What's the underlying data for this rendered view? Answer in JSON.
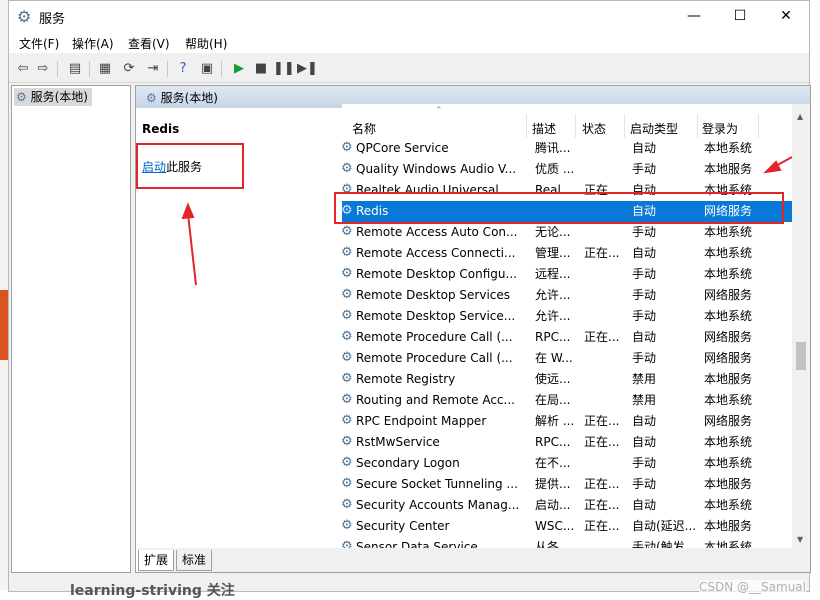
{
  "window": {
    "title": "服务",
    "min": "—",
    "max": "☐",
    "close": "✕"
  },
  "menu": [
    "文件(F)",
    "操作(A)",
    "查看(V)",
    "帮助(H)"
  ],
  "left_tree": {
    "root": "服务(本地)"
  },
  "right_header": "服务(本地)",
  "detail": {
    "service_name": "Redis",
    "start_link": "启动",
    "start_suffix": "此服务"
  },
  "columns": [
    "名称",
    "描述",
    "状态",
    "启动类型",
    "登录为"
  ],
  "services": [
    {
      "name": "QPCore Service",
      "desc": "腾讯...",
      "status": "",
      "start": "自动",
      "logon": "本地系统"
    },
    {
      "name": "Quality Windows Audio V...",
      "desc": "优质 ...",
      "status": "",
      "start": "手动",
      "logon": "本地服务"
    },
    {
      "name": "Realtek Audio Universal ...",
      "desc": "Real...",
      "status": "正在...",
      "start": "自动",
      "logon": "本地系统"
    },
    {
      "name": "Redis",
      "desc": "",
      "status": "",
      "start": "自动",
      "logon": "网络服务",
      "selected": true
    },
    {
      "name": "Remote Access Auto Con...",
      "desc": "无论...",
      "status": "",
      "start": "手动",
      "logon": "本地系统"
    },
    {
      "name": "Remote Access Connecti...",
      "desc": "管理...",
      "status": "正在...",
      "start": "自动",
      "logon": "本地系统"
    },
    {
      "name": "Remote Desktop Configu...",
      "desc": "远程...",
      "status": "",
      "start": "手动",
      "logon": "本地系统"
    },
    {
      "name": "Remote Desktop Services",
      "desc": "允许...",
      "status": "",
      "start": "手动",
      "logon": "网络服务"
    },
    {
      "name": "Remote Desktop Service...",
      "desc": "允许...",
      "status": "",
      "start": "手动",
      "logon": "本地系统"
    },
    {
      "name": "Remote Procedure Call (...",
      "desc": "RPC...",
      "status": "正在...",
      "start": "自动",
      "logon": "网络服务"
    },
    {
      "name": "Remote Procedure Call (...",
      "desc": "在 W...",
      "status": "",
      "start": "手动",
      "logon": "网络服务"
    },
    {
      "name": "Remote Registry",
      "desc": "使远...",
      "status": "",
      "start": "禁用",
      "logon": "本地服务"
    },
    {
      "name": "Routing and Remote Acc...",
      "desc": "在局...",
      "status": "",
      "start": "禁用",
      "logon": "本地系统"
    },
    {
      "name": "RPC Endpoint Mapper",
      "desc": "解析 ...",
      "status": "正在...",
      "start": "自动",
      "logon": "网络服务"
    },
    {
      "name": "RstMwService",
      "desc": "RPC...",
      "status": "正在...",
      "start": "自动",
      "logon": "本地系统"
    },
    {
      "name": "Secondary Logon",
      "desc": "在不...",
      "status": "",
      "start": "手动",
      "logon": "本地系统"
    },
    {
      "name": "Secure Socket Tunneling ...",
      "desc": "提供...",
      "status": "正在...",
      "start": "手动",
      "logon": "本地服务"
    },
    {
      "name": "Security Accounts Manag...",
      "desc": "启动...",
      "status": "正在...",
      "start": "自动",
      "logon": "本地系统"
    },
    {
      "name": "Security Center",
      "desc": "WSC...",
      "status": "正在...",
      "start": "自动(延迟...",
      "logon": "本地服务"
    },
    {
      "name": "Sensor Data Service",
      "desc": "从各...",
      "status": "",
      "start": "手动(触发...",
      "logon": "本地系统"
    }
  ],
  "tabs": [
    "扩展",
    "标准"
  ],
  "bottom_text": "learning-striving",
  "bottom_follow": "关注",
  "watermark": "CSDN @__Samual",
  "colors": {
    "selection": "#0a78d7",
    "annotation": "#e3242b",
    "link": "#0066cc"
  }
}
